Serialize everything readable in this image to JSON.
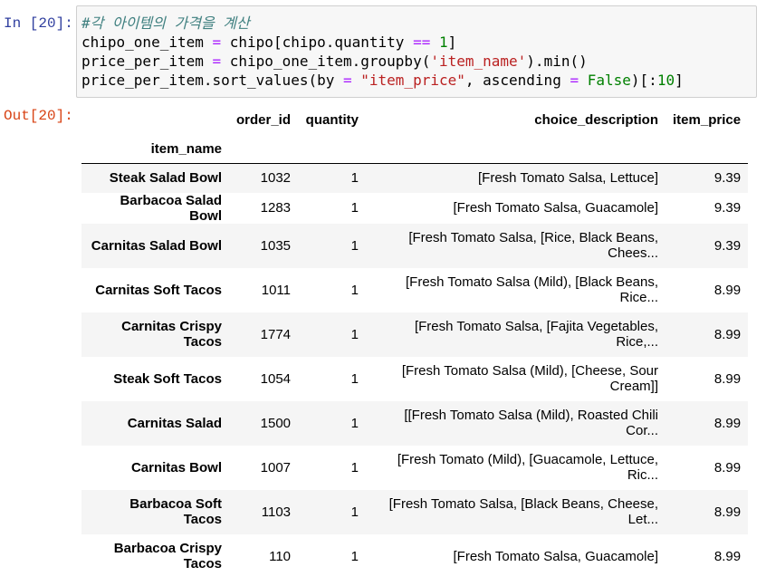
{
  "input_prompt": "In [20]:",
  "output_prompt": "Out[20]:",
  "code": {
    "comment": "#각 아이템의 가격을 계산",
    "line2": {
      "a": "chipo_one_item ",
      "op1": "=",
      "b": " chipo[chipo.quantity ",
      "op2": "==",
      "sp": " ",
      "num": "1",
      "end": "]"
    },
    "line3": {
      "a": "price_per_item ",
      "op1": "=",
      "b": " chipo_one_item.groupby(",
      "str": "'item_name'",
      "end": ").min()"
    },
    "line4": {
      "a": "price_per_item.sort_values(by ",
      "op1": "=",
      "sp1": " ",
      "str": "\"item_price\"",
      "b": ", ascending ",
      "op2": "=",
      "sp2": " ",
      "kw": "False",
      "c": ")[:",
      "num": "10",
      "end": "]"
    }
  },
  "table": {
    "columns": [
      "order_id",
      "quantity",
      "choice_description",
      "item_price"
    ],
    "index_name": "item_name",
    "rows": [
      {
        "item_name": "Steak Salad Bowl",
        "order_id": "1032",
        "quantity": "1",
        "choice_description": "[Fresh Tomato Salsa, Lettuce]",
        "item_price": "9.39"
      },
      {
        "item_name": "Barbacoa Salad Bowl",
        "order_id": "1283",
        "quantity": "1",
        "choice_description": "[Fresh Tomato Salsa, Guacamole]",
        "item_price": "9.39"
      },
      {
        "item_name": "Carnitas Salad Bowl",
        "order_id": "1035",
        "quantity": "1",
        "choice_description": "[Fresh Tomato Salsa, [Rice, Black Beans, Chees...",
        "item_price": "9.39"
      },
      {
        "item_name": "Carnitas Soft Tacos",
        "order_id": "1011",
        "quantity": "1",
        "choice_description": "[Fresh Tomato Salsa (Mild), [Black Beans, Rice...",
        "item_price": "8.99"
      },
      {
        "item_name": "Carnitas Crispy Tacos",
        "order_id": "1774",
        "quantity": "1",
        "choice_description": "[Fresh Tomato Salsa, [Fajita Vegetables, Rice,...",
        "item_price": "8.99"
      },
      {
        "item_name": "Steak Soft Tacos",
        "order_id": "1054",
        "quantity": "1",
        "choice_description": "[Fresh Tomato Salsa (Mild), [Cheese, Sour Cream]]",
        "item_price": "8.99"
      },
      {
        "item_name": "Carnitas Salad",
        "order_id": "1500",
        "quantity": "1",
        "choice_description": "[[Fresh Tomato Salsa (Mild), Roasted Chili Cor...",
        "item_price": "8.99"
      },
      {
        "item_name": "Carnitas Bowl",
        "order_id": "1007",
        "quantity": "1",
        "choice_description": "[Fresh Tomato (Mild), [Guacamole, Lettuce, Ric...",
        "item_price": "8.99"
      },
      {
        "item_name": "Barbacoa Soft Tacos",
        "order_id": "1103",
        "quantity": "1",
        "choice_description": "[Fresh Tomato Salsa, [Black Beans, Cheese, Let...",
        "item_price": "8.99"
      },
      {
        "item_name": "Barbacoa Crispy Tacos",
        "order_id": "110",
        "quantity": "1",
        "choice_description": "[Fresh Tomato Salsa, Guacamole]",
        "item_price": "8.99"
      }
    ]
  }
}
